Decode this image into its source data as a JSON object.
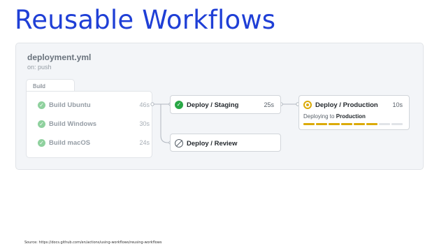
{
  "slide": {
    "title": "Reusable Workflows"
  },
  "workflow": {
    "file": "deployment.yml",
    "trigger": "on: push",
    "build_group": {
      "label": "Build",
      "jobs": [
        {
          "label": "Build Ubuntu",
          "duration": "46s"
        },
        {
          "label": "Build Windows",
          "duration": "30s"
        },
        {
          "label": "Build macOS",
          "duration": "24s"
        }
      ]
    },
    "staging": {
      "label": "Deploy / Staging",
      "duration": "25s",
      "status": "success"
    },
    "review": {
      "label": "Deploy / Review",
      "status": "skipped"
    },
    "production": {
      "label": "Deploy / Production",
      "duration": "10s",
      "status": "in-progress",
      "deploying_prefix": "Deploying to",
      "deploying_target": "Production",
      "progress": 0.77
    }
  },
  "colors": {
    "title": "#1f3fd6",
    "success": "#28a745",
    "in_progress": "#dbab09",
    "track": "#e1e4e8"
  },
  "footer": {
    "source": "Source: https://docs.github.com/en/actions/using-workflows/reusing-workflows"
  }
}
